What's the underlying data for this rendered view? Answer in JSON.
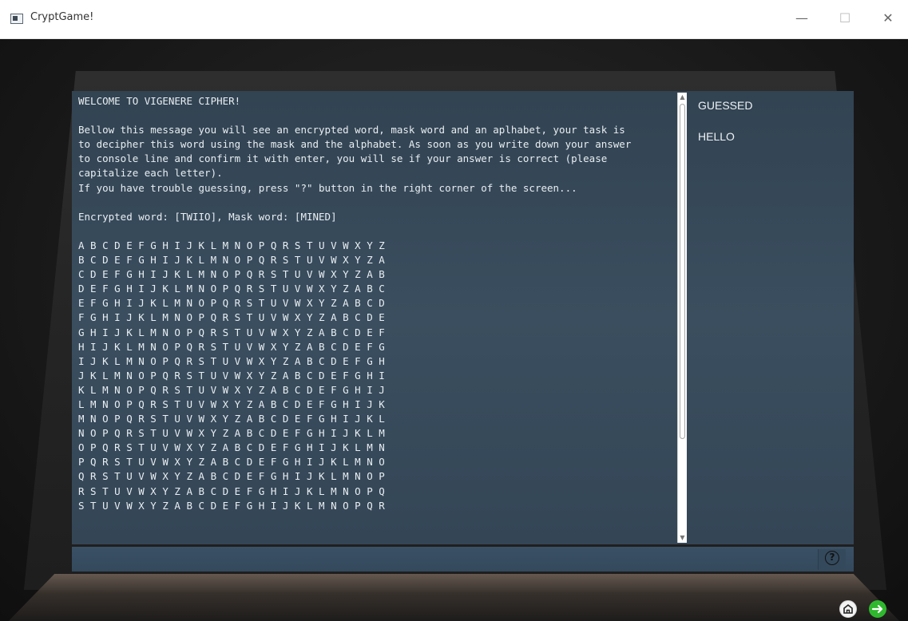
{
  "window": {
    "title": "CryptGame!",
    "minimize_glyph": "—",
    "maximize_glyph": "☐",
    "close_glyph": "✕"
  },
  "console": {
    "text": "WELCOME TO VIGENERE CIPHER!\n\nBellow this message you will see an encrypted word, mask word and an aplhabet, your task is\nto decipher this word using the mask and the alphabet. As soon as you write down your answer\nto console line and confirm it with enter, you will se if your answer is correct (please\ncapitalize each letter).\nIf you have trouble guessing, press \"?\" button in the right corner of the screen...\n\nEncrypted word: [TWIIO], Mask word: [MINED]\n\nA B C D E F G H I J K L M N O P Q R S T U V W X Y Z\nB C D E F G H I J K L M N O P Q R S T U V W X Y Z A\nC D E F G H I J K L M N O P Q R S T U V W X Y Z A B\nD E F G H I J K L M N O P Q R S T U V W X Y Z A B C\nE F G H I J K L M N O P Q R S T U V W X Y Z A B C D\nF G H I J K L M N O P Q R S T U V W X Y Z A B C D E\nG H I J K L M N O P Q R S T U V W X Y Z A B C D E F\nH I J K L M N O P Q R S T U V W X Y Z A B C D E F G\nI J K L M N O P Q R S T U V W X Y Z A B C D E F G H\nJ K L M N O P Q R S T U V W X Y Z A B C D E F G H I\nK L M N O P Q R S T U V W X Y Z A B C D E F G H I J\nL M N O P Q R S T U V W X Y Z A B C D E F G H I J K\nM N O P Q R S T U V W X Y Z A B C D E F G H I J K L\nN O P Q R S T U V W X Y Z A B C D E F G H I J K L M\nO P Q R S T U V W X Y Z A B C D E F G H I J K L M N\nP Q R S T U V W X Y Z A B C D E F G H I J K L M N O\nQ R S T U V W X Y Z A B C D E F G H I J K L M N O P\nR S T U V W X Y Z A B C D E F G H I J K L M N O P Q\nS T U V W X Y Z A B C D E F G H I J K L M N O P Q R"
  },
  "side_panel": {
    "heading": "GUESSED",
    "guessed_word": "HELLO"
  },
  "input": {
    "value": ""
  },
  "help_button": {
    "glyph": "?"
  },
  "colors": {
    "screen": "#3a4e5f",
    "console_text": "#e9eef2",
    "next_button": "#2fb82e"
  }
}
